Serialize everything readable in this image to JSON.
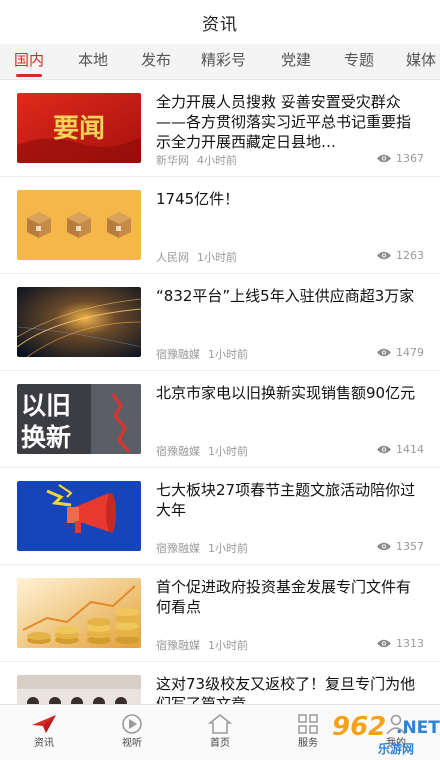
{
  "header": {
    "title": "资讯"
  },
  "tabs": [
    {
      "label": "国内",
      "active": true
    },
    {
      "label": "本地",
      "active": false
    },
    {
      "label": "发布",
      "active": false
    },
    {
      "label": "精彩号",
      "active": false
    },
    {
      "label": "党建",
      "active": false
    },
    {
      "label": "专题",
      "active": false
    },
    {
      "label": "媒体",
      "active": false
    }
  ],
  "articles": [
    {
      "title": "全力开展人员搜救 妥善安置受灾群众——各方贯彻落实习近平总书记重要指示全力开展西藏定日县地…",
      "source": "新华网",
      "time": "4小时前",
      "views": "1367",
      "thumb_text": "要闻"
    },
    {
      "title": "1745亿件！",
      "source": "人民网",
      "time": "1小时前",
      "views": "1263"
    },
    {
      "title": "“832平台”上线5年入驻供应商超3万家",
      "source": "宿豫融媒",
      "time": "1小时前",
      "views": "1479"
    },
    {
      "title": "北京市家电以旧换新实现销售额90亿元",
      "source": "宿豫融媒",
      "time": "1小时前",
      "views": "1414",
      "thumb_text_line1": "以旧",
      "thumb_text_line2": "换新"
    },
    {
      "title": "七大板块27项春节主题文旅活动陪你过大年",
      "source": "宿豫融媒",
      "time": "1小时前",
      "views": "1357"
    },
    {
      "title": "首个促进政府投资基金发展专门文件有何看点",
      "source": "宿豫融媒",
      "time": "1小时前",
      "views": "1313"
    },
    {
      "title": "这对73级校友又返校了！复旦专门为他们写了篇文章",
      "source": "",
      "time": "",
      "views": ""
    }
  ],
  "tabbar": [
    {
      "label": "资讯",
      "icon": "paper-plane-icon"
    },
    {
      "label": "视听",
      "icon": "play-circle-icon"
    },
    {
      "label": "首页",
      "icon": "home-icon"
    },
    {
      "label": "服务",
      "icon": "grid-icon"
    },
    {
      "label": "我的",
      "icon": "user-icon"
    }
  ],
  "watermark": {
    "num": "962",
    "net": ".NET",
    "sub": "乐游网"
  },
  "colors": {
    "accent": "#d72a25",
    "meta": "#9a9a9a"
  }
}
